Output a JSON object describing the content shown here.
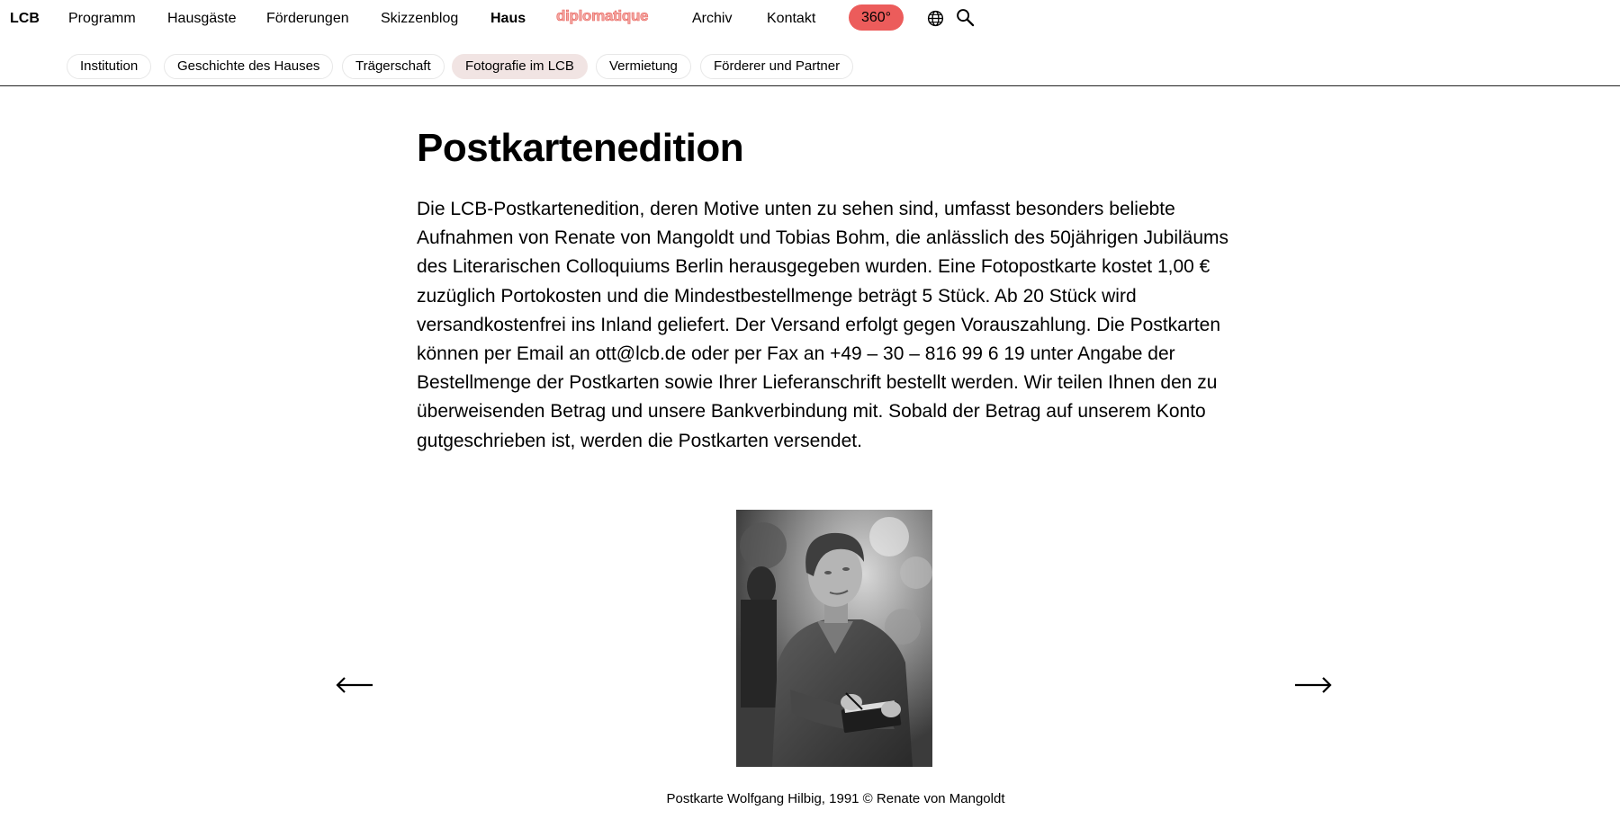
{
  "header": {
    "logo": "LCB",
    "nav": {
      "programm": "Programm",
      "hausgaeste": "Hausgäste",
      "foerderungen": "Förderungen",
      "skizzenblog": "Skizzenblog",
      "haus": "Haus",
      "diplomatique": "diplomatique",
      "archiv": "Archiv",
      "kontakt": "Kontakt",
      "view360": "360°"
    },
    "icons": [
      "globe-icon",
      "search-icon"
    ],
    "accent_color": "#ec5c5b"
  },
  "subnav": {
    "items": [
      {
        "label": "Institution"
      },
      {
        "label": "Geschichte des Hauses"
      },
      {
        "label": "Trägerschaft"
      },
      {
        "label": "Fotografie im LCB"
      },
      {
        "label": "Vermietung"
      },
      {
        "label": "Förderer und Partner"
      }
    ],
    "active": "Fotografie im LCB"
  },
  "main": {
    "title": "Postkartenedition",
    "body": "Die LCB-Postkartenedition, deren Motive unten zu sehen sind, umfasst besonders beliebte Aufnahmen von Renate von Mangoldt und Tobias Bohm, die anlässlich des 50jährigen Jubiläums des Literarischen Colloquiums Berlin herausgegeben wurden.  Eine Fotopostkarte kostet 1,00 € zuzüglich Portokosten und die Mindestbestellmenge beträgt 5 Stück. Ab 20 Stück wird versandkostenfrei ins Inland geliefert. Der Versand erfolgt gegen Vorauszahlung. Die Postkarten können per Email an ott@lcb.de oder per Fax an +49 – 30 – 816 99 6 19 unter Angabe der Bestellmenge der Postkarten sowie Ihrer Lieferanschrift bestellt werden. Wir teilen Ihnen den zu überweisenden Betrag und unsere Bankverbindung mit. Sobald der Betrag auf unserem Konto gutgeschrieben ist, werden die Postkarten versendet."
  },
  "carousel": {
    "caption": "Postkarte Wolfgang Hilbig, 1991  © Renate von Mangoldt",
    "prev_icon": "arrow-left-icon",
    "next_icon": "arrow-right-icon"
  }
}
